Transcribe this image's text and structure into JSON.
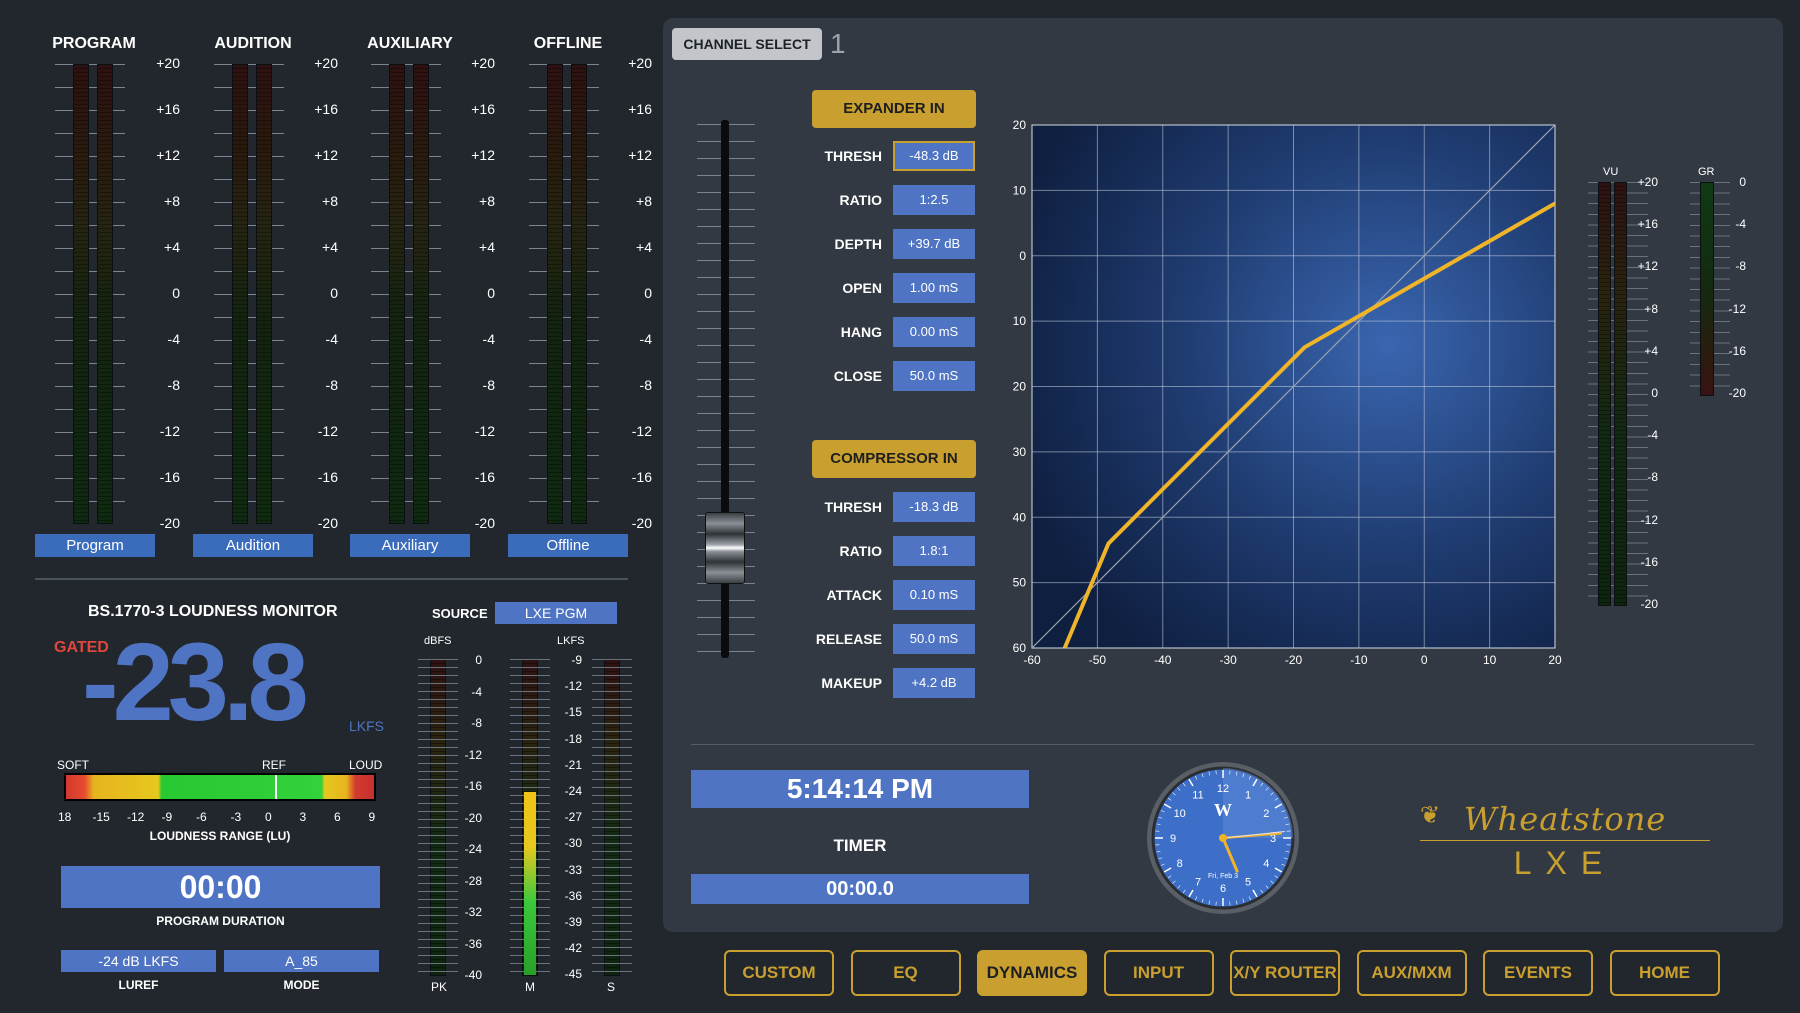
{
  "meters": [
    {
      "title": "PROGRAM",
      "label": "Program"
    },
    {
      "title": "AUDITION",
      "label": "Audition"
    },
    {
      "title": "AUXILIARY",
      "label": "Auxiliary"
    },
    {
      "title": "OFFLINE",
      "label": "Offline"
    }
  ],
  "meter_scale": [
    "+20",
    "+16",
    "+12",
    "+8",
    "+4",
    "0",
    "-4",
    "-8",
    "-12",
    "-16",
    "-20"
  ],
  "loudness": {
    "title": "BS.1770-3 LOUDNESS MONITOR",
    "gated": "GATED",
    "value": "-23.8",
    "unit": "LKFS",
    "source_label": "SOURCE",
    "source_value": "LXE PGM",
    "range_labels": {
      "soft": "SOFT",
      "ref": "REF",
      "loud": "LOUD"
    },
    "range_ticks": [
      "18",
      "-15",
      "-12",
      "-9",
      "-6",
      "-3",
      "0",
      "3",
      "6",
      "9"
    ],
    "range_title": "LOUDNESS RANGE (LU)",
    "duration": "00:00",
    "duration_label": "PROGRAM DURATION",
    "luref": "-24 dB LKFS",
    "luref_label": "LUREF",
    "mode": "A_85",
    "mode_label": "MODE",
    "dbfs_label": "dBFS",
    "lkfs_label": "LKFS",
    "dbfs_scale": [
      "0",
      "-4",
      "-8",
      "-12",
      "-16",
      "-20",
      "-24",
      "-28",
      "-32",
      "-36",
      "-40"
    ],
    "lkfs_scale": [
      "-9",
      "-12",
      "-15",
      "-18",
      "-21",
      "-24",
      "-27",
      "-30",
      "-33",
      "-36",
      "-39",
      "-42",
      "-45"
    ],
    "bar_labels": {
      "pk": "PK",
      "m": "M",
      "s": "S"
    },
    "m_level_fraction": 0.58
  },
  "channel": {
    "select_label": "CHANNEL SELECT",
    "number": "1"
  },
  "expander": {
    "button": "EXPANDER IN",
    "fields": [
      {
        "label": "THRESH",
        "value": "-48.3 dB"
      },
      {
        "label": "RATIO",
        "value": "1:2.5"
      },
      {
        "label": "DEPTH",
        "value": "+39.7 dB"
      },
      {
        "label": "OPEN",
        "value": "1.00 mS"
      },
      {
        "label": "HANG",
        "value": "0.00 mS"
      },
      {
        "label": "CLOSE",
        "value": "50.0 mS"
      }
    ]
  },
  "compressor": {
    "button": "COMPRESSOR IN",
    "fields": [
      {
        "label": "THRESH",
        "value": "-18.3 dB"
      },
      {
        "label": "RATIO",
        "value": "1.8:1"
      },
      {
        "label": "ATTACK",
        "value": "0.10 mS"
      },
      {
        "label": "RELEASE",
        "value": "50.0 mS"
      },
      {
        "label": "MAKEUP",
        "value": "+4.2 dB"
      }
    ]
  },
  "chart_data": {
    "type": "line",
    "title": "",
    "xlabel": "",
    "ylabel": "",
    "x_ticks": [
      "-60",
      "-50",
      "-40",
      "-30",
      "-20",
      "-10",
      "0",
      "10",
      "20"
    ],
    "y_ticks": [
      "20",
      "10",
      "0",
      "10",
      "20",
      "30",
      "40",
      "50",
      "60"
    ],
    "xlim": [
      -60,
      20
    ],
    "ylim": [
      -60,
      20
    ],
    "grid": true,
    "series": [
      {
        "values": [
          [
            -60,
            -60
          ],
          [
            20,
            20
          ]
        ],
        "color": "#9aa3ad"
      },
      {
        "values": [
          [
            -55,
            -60
          ],
          [
            -48.3,
            -44
          ],
          [
            -18.3,
            -14
          ],
          [
            20,
            8
          ]
        ],
        "color": "#f0b429"
      }
    ]
  },
  "vu": {
    "label": "VU",
    "scale": [
      "+20",
      "+16",
      "+12",
      "+8",
      "+4",
      "0",
      "-4",
      "-8",
      "-12",
      "-16",
      "-20"
    ]
  },
  "gr": {
    "label": "GR",
    "scale": [
      "0",
      "-4",
      "-8",
      "-12",
      "-16",
      "-20"
    ]
  },
  "clock": {
    "time": "5:14:14 PM",
    "timer_label": "TIMER",
    "timer": "00:00.0",
    "date": "Fri, Feb 3",
    "numbers": [
      "12",
      "1",
      "2",
      "3",
      "4",
      "5",
      "6",
      "7",
      "8",
      "9",
      "10",
      "11"
    ]
  },
  "brand": {
    "name": "Wheatstone",
    "model": "LXE"
  },
  "nav": [
    "CUSTOM",
    "EQ",
    "DYNAMICS",
    "INPUT",
    "X/Y ROUTER",
    "AUX/MXM",
    "EVENTS",
    "HOME"
  ],
  "nav_active": "DYNAMICS",
  "colors": {
    "accent": "#c9a030",
    "blue": "#4e74c3",
    "curve": "#f0b429",
    "panel": "#323942",
    "bg": "#22272d"
  }
}
